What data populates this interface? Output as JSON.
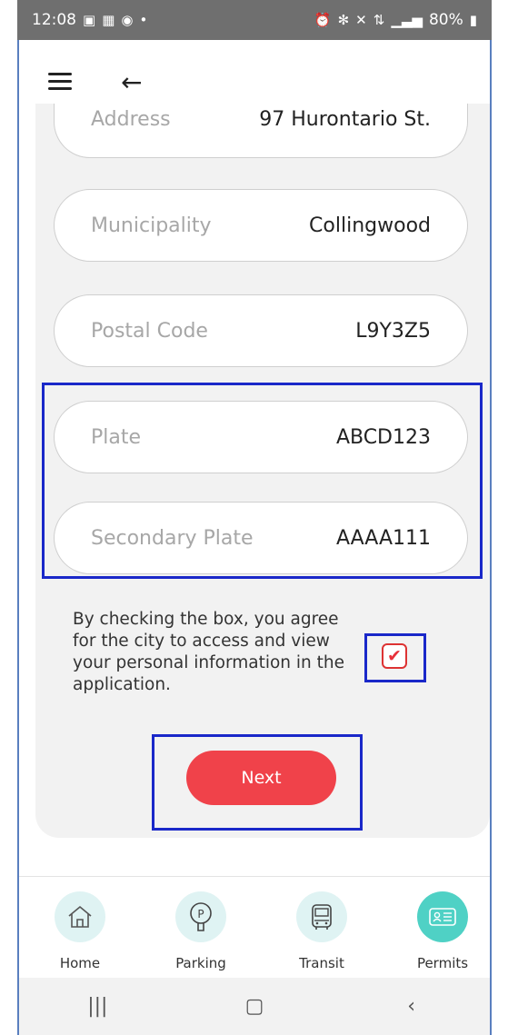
{
  "status_bar": {
    "time": "12:08",
    "battery": "80%"
  },
  "fields": [
    {
      "label": "Address",
      "value": "97 Hurontario St."
    },
    {
      "label": "Municipality",
      "value": "Collingwood"
    },
    {
      "label": "Postal Code",
      "value": "L9Y3Z5"
    },
    {
      "label": "Plate",
      "value": "ABCD123"
    },
    {
      "label": "Secondary Plate",
      "value": "AAAA111"
    }
  ],
  "consent": {
    "text": "By checking the box, you agree for the city to access and view your personal information in the application.",
    "checked": true
  },
  "next_label": "Next",
  "nav": [
    {
      "label": "Home",
      "icon": "home-icon"
    },
    {
      "label": "Parking",
      "icon": "parking-meter-icon"
    },
    {
      "label": "Transit",
      "icon": "bus-icon"
    },
    {
      "label": "Permits",
      "icon": "permit-card-icon",
      "active": true
    }
  ],
  "colors": {
    "accent": "#f0424a",
    "nav_active": "#4fd1c5",
    "nav_bg": "#dff3f3",
    "highlight": "#1a28c9"
  }
}
